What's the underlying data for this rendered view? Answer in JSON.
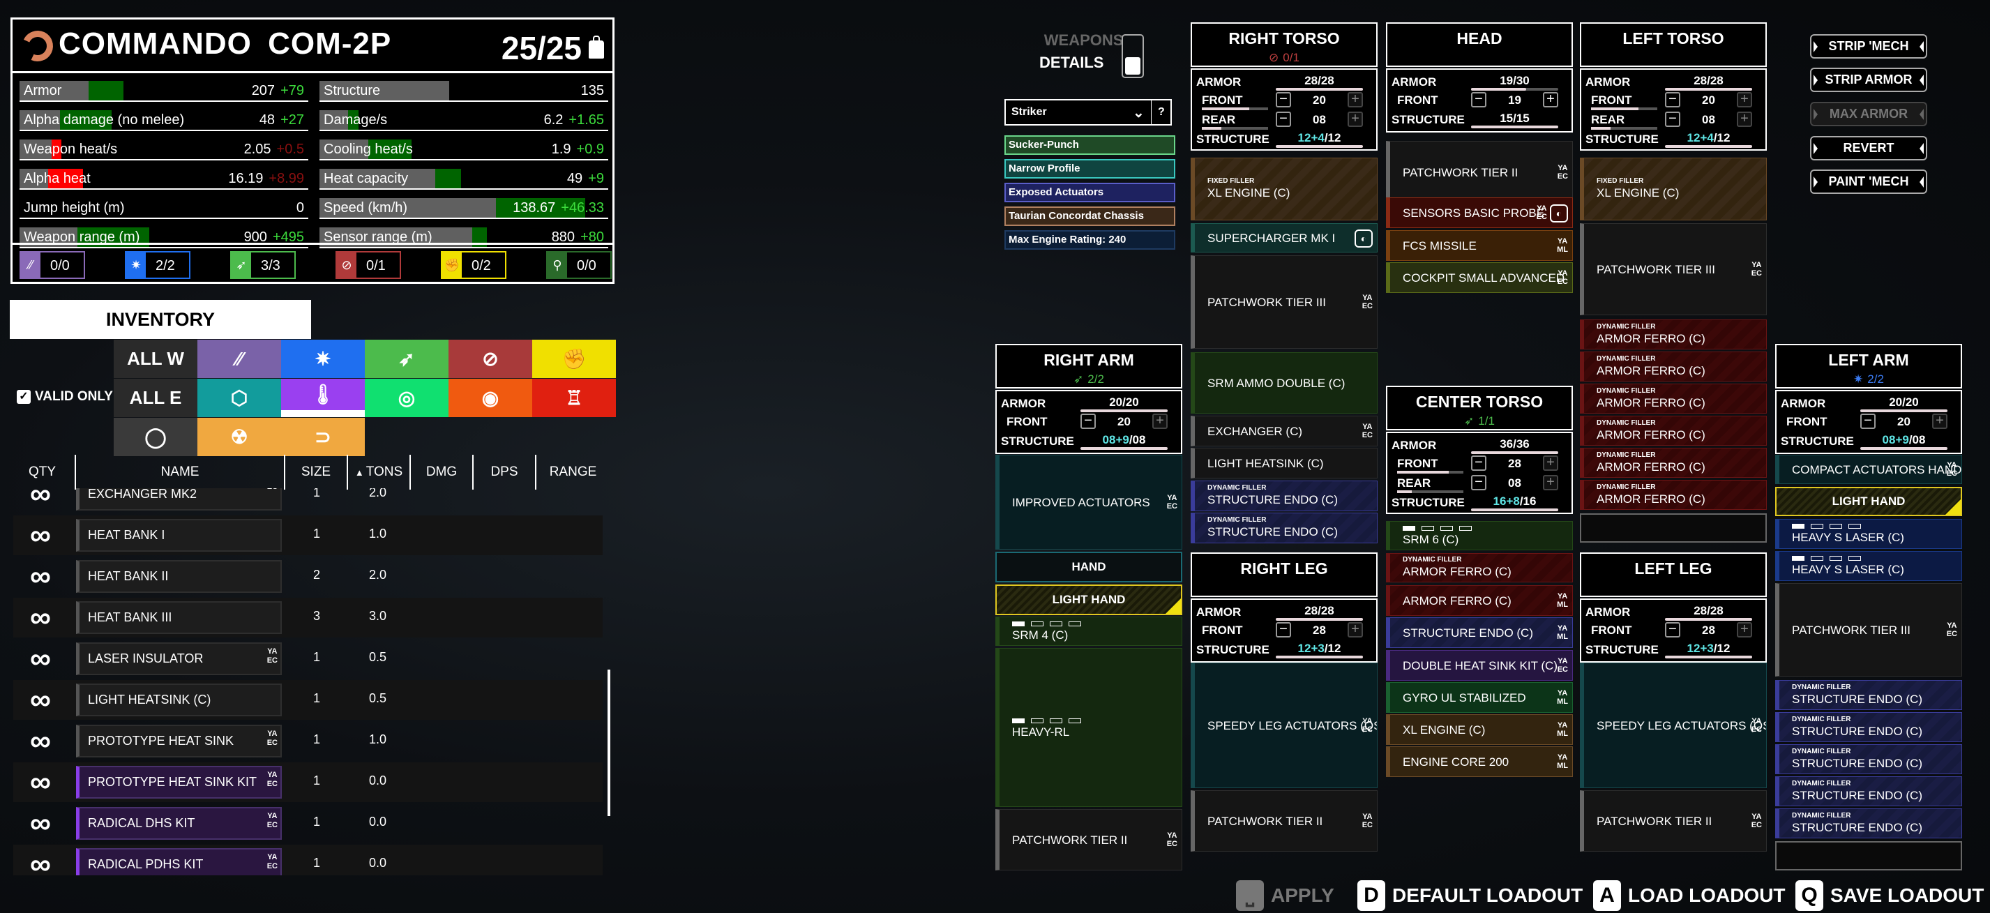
{
  "mech": {
    "name": "COMMANDO  COM-2P",
    "tonnage": "25/25",
    "stats_left": [
      {
        "label": "Armor",
        "value": "207",
        "delta": "+79",
        "delta_sign": "pos",
        "base_frac": 0.24,
        "delta_frac": 0.12,
        "delta_color": "#006400"
      },
      {
        "label": "Alpha damage (no melee)",
        "value": "48",
        "delta": "+27",
        "delta_sign": "pos",
        "base_frac": 0.14,
        "delta_frac": 0.18,
        "delta_color": "#006400"
      },
      {
        "label": "Weapon heat/s",
        "value": "2.05",
        "delta": "+0.5",
        "delta_sign": "neg",
        "base_frac": 0.11,
        "delta_frac": 0.035,
        "delta_color": "#ff0000"
      },
      {
        "label": "Alpha heat",
        "value": "16.19",
        "delta": "+8.99",
        "delta_sign": "neg",
        "base_frac": 0.1,
        "delta_frac": 0.12,
        "delta_color": "#ff0000"
      },
      {
        "label": "Jump height (m)",
        "value": "0",
        "delta": "",
        "delta_sign": "pos",
        "base_frac": 0,
        "delta_frac": 0,
        "delta_color": "#006400"
      },
      {
        "label": "Weapon range (m)",
        "value": "900",
        "delta": "+495",
        "delta_sign": "pos",
        "base_frac": 0.2,
        "delta_frac": 0.25,
        "delta_color": "#006400"
      }
    ],
    "stats_right": [
      {
        "label": "Structure",
        "value": "135",
        "delta": "",
        "delta_sign": "pos",
        "base_frac": 0.45,
        "delta_frac": 0,
        "delta_color": "#006400"
      },
      {
        "label": "Damage/s",
        "value": "6.2",
        "delta": "+1.65",
        "delta_sign": "pos",
        "base_frac": 0.1,
        "delta_frac": 0.035,
        "delta_color": "#006400"
      },
      {
        "label": "Cooling heat/s",
        "value": "1.9",
        "delta": "+0.9",
        "delta_sign": "pos",
        "base_frac": 0.17,
        "delta_frac": 0.15,
        "delta_color": "#006400"
      },
      {
        "label": "Heat capacity",
        "value": "49",
        "delta": "+9",
        "delta_sign": "pos",
        "base_frac": 0.4,
        "delta_frac": 0.09,
        "delta_color": "#006400"
      },
      {
        "label": "Speed (km/h)",
        "value": "138.67",
        "delta": "+46.33",
        "delta_sign": "pos",
        "base_frac": 0.61,
        "delta_frac": 0.31,
        "delta_color": "#006400"
      },
      {
        "label": "Sensor range (m)",
        "value": "880",
        "delta": "+80",
        "delta_sign": "pos",
        "base_frac": 0.53,
        "delta_frac": 0.05,
        "delta_color": "#006400"
      }
    ],
    "hardpoints": [
      {
        "icon": "ballistic-icon",
        "glyph": "⁄⁄",
        "value": "0/0",
        "color": "#8a6ab8"
      },
      {
        "icon": "energy-icon",
        "glyph": "✷",
        "value": "2/2",
        "color": "#1f6ff0"
      },
      {
        "icon": "missile-icon",
        "glyph": "➶",
        "value": "3/3",
        "color": "#4cbb4c"
      },
      {
        "icon": "support-icon",
        "glyph": "⊘",
        "value": "0/1",
        "color": "#b03a3a"
      },
      {
        "icon": "melee-icon",
        "glyph": "✊",
        "value": "0/2",
        "color": "#f0e000"
      },
      {
        "icon": "jumpjet-icon",
        "glyph": "⚲",
        "value": "0/0",
        "color": "#2a6a2a"
      }
    ]
  },
  "inventory": {
    "tab_label": "INVENTORY",
    "valid_only_label": "VALID ONLY",
    "filters_row1": [
      {
        "label": "ALL W",
        "name": "all-weapons",
        "bg": "#2a2a2a"
      },
      {
        "label": "⁄⁄",
        "name": "ballistic",
        "bg": "#7a62a8"
      },
      {
        "label": "✷",
        "name": "energy",
        "bg": "#1f6ff0"
      },
      {
        "label": "➶",
        "name": "missile",
        "bg": "#4cbb4c"
      },
      {
        "label": "⊘",
        "name": "support",
        "bg": "#a83a3a"
      },
      {
        "label": "✊",
        "name": "melee",
        "bg": "#f0e000"
      }
    ],
    "filters_row2": [
      {
        "label": "ALL E",
        "name": "all-equipment",
        "bg": "#2a2a2a"
      },
      {
        "label": "⬡",
        "name": "upgrades",
        "bg": "#129c9c"
      },
      {
        "label": "🌡",
        "name": "heatsinks",
        "bg": "#9a40f0"
      },
      {
        "label": "◎",
        "name": "gyros",
        "bg": "#10e070"
      },
      {
        "label": "◉",
        "name": "sensors",
        "bg": "#f05a10"
      },
      {
        "label": "♖",
        "name": "actuators",
        "bg": "#e02010"
      }
    ],
    "filters_row3": [
      {
        "label": "◯",
        "name": "cockpit",
        "bg": "#3a3a3a"
      },
      {
        "label": "☢",
        "name": "engine",
        "bg": "#f0a840"
      },
      {
        "label": "⊃",
        "name": "jumpjets",
        "bg": "#f0a840"
      }
    ],
    "columns": [
      "QTY",
      "NAME",
      "SIZE",
      "TONS",
      "DMG",
      "DPS",
      "RANGE"
    ],
    "sort_column": "TONS",
    "rows": [
      {
        "qty": "∞",
        "name": "EXCHANGER MK2",
        "size": "1",
        "tons": "2.0",
        "mfr": "EC",
        "color": "grey"
      },
      {
        "qty": "∞",
        "name": "HEAT BANK I",
        "size": "1",
        "tons": "1.0",
        "mfr": "",
        "color": "grey"
      },
      {
        "qty": "∞",
        "name": "HEAT BANK II",
        "size": "2",
        "tons": "2.0",
        "mfr": "",
        "color": "grey"
      },
      {
        "qty": "∞",
        "name": "HEAT BANK III",
        "size": "3",
        "tons": "3.0",
        "mfr": "",
        "color": "grey"
      },
      {
        "qty": "∞",
        "name": "LASER INSULATOR",
        "size": "1",
        "tons": "0.5",
        "mfr": "YA EC",
        "color": "grey"
      },
      {
        "qty": "∞",
        "name": "LIGHT HEATSINK (C)",
        "size": "1",
        "tons": "0.5",
        "mfr": "",
        "color": "grey"
      },
      {
        "qty": "∞",
        "name": "PROTOTYPE HEAT SINK",
        "size": "1",
        "tons": "1.0",
        "mfr": "YA EC",
        "color": "grey"
      },
      {
        "qty": "∞",
        "name": "PROTOTYPE HEAT SINK KIT",
        "size": "1",
        "tons": "0.0",
        "mfr": "YA EC",
        "color": "purple"
      },
      {
        "qty": "∞",
        "name": "RADICAL DHS KIT",
        "size": "1",
        "tons": "0.0",
        "mfr": "YA EC",
        "color": "purple"
      },
      {
        "qty": "∞",
        "name": "RADICAL PDHS KIT",
        "size": "1",
        "tons": "0.0",
        "mfr": "YA EC",
        "color": "purple"
      }
    ]
  },
  "details": {
    "weapons_label": "WEAPONS",
    "details_label": "DETAILS",
    "quirk_select": "Striker",
    "help": "?",
    "quirks": [
      {
        "label": "Sucker-Punch",
        "bg": "#1f4a26",
        "border": "#6ad68a"
      },
      {
        "label": "Narrow Profile",
        "bg": "#0f4440",
        "border": "#3ac8c0"
      },
      {
        "label": "Exposed Actuators",
        "bg": "#1e2260",
        "border": "#5a5ec8"
      },
      {
        "label": "Taurian Concordat Chassis",
        "bg": "#3a2818",
        "border": "#b08060"
      },
      {
        "label": "Max Engine Rating:  240",
        "bg": "#0c1e36",
        "border": "#1e3a60"
      }
    ]
  },
  "components": {
    "right_torso": {
      "title": "RIGHT TORSO",
      "hardpoint": "0/1",
      "armor": "28/28",
      "front": "20",
      "rear": "08",
      "structure_base": "12",
      "structure_bonus": "+4",
      "structure_max": "/12",
      "front_frac": 0.72,
      "rear_frac": 0.29
    },
    "head": {
      "title": "HEAD",
      "armor": "19/30",
      "armor_frac": 0.63,
      "front": "19",
      "structure": "15/15"
    },
    "left_torso": {
      "title": "LEFT TORSO",
      "armor": "28/28",
      "front": "20",
      "rear": "08",
      "structure_base": "12",
      "structure_bonus": "+4",
      "structure_max": "/12",
      "front_frac": 0.72,
      "rear_frac": 0.29
    },
    "right_arm": {
      "title": "RIGHT ARM",
      "hardpoint": "2/2",
      "armor": "20/20",
      "front": "20",
      "structure_base": "08",
      "structure_bonus": "+9",
      "structure_max": "/08"
    },
    "center_torso": {
      "title": "CENTER TORSO",
      "hardpoint": "1/1",
      "armor": "36/36",
      "front": "28",
      "rear": "08",
      "structure_base": "16",
      "structure_bonus": "+8",
      "structure_max": "/16",
      "front_frac": 0.78,
      "rear_frac": 0.22
    },
    "left_arm": {
      "title": "LEFT ARM",
      "hardpoint": "2/2",
      "armor": "20/20",
      "front": "20",
      "structure_base": "08",
      "structure_bonus": "+9",
      "structure_max": "/08"
    },
    "right_leg": {
      "title": "RIGHT LEG",
      "armor": "28/28",
      "front": "28",
      "structure_base": "12",
      "structure_bonus": "+3",
      "structure_max": "/12"
    },
    "left_leg": {
      "title": "LEFT LEG",
      "armor": "28/28",
      "front": "28",
      "structure_base": "12",
      "structure_bonus": "+3",
      "structure_max": "/12"
    },
    "labels": {
      "armor": "ARMOR",
      "front": "FRONT",
      "rear": "REAR",
      "structure": "STRUCTURE",
      "hand": "HAND",
      "light_hand": "LIGHT HAND",
      "fixed_filler": "FIXED FILLER",
      "dynamic_filler": "DYNAMIC FILLER"
    }
  },
  "slots": {
    "right_torso": [
      {
        "name": "XL ENGINE (C)",
        "filler": "FIXED FILLER"
      },
      {
        "name": "SUPERCHARGER MK I"
      },
      {
        "name": "PATCHWORK TIER III",
        "mfr": "YA EC"
      },
      {
        "name": "SRM AMMO DOUBLE (C)"
      },
      {
        "name": "EXCHANGER (C)",
        "mfr": "YA EC"
      },
      {
        "name": "LIGHT HEATSINK (C)"
      },
      {
        "name": "STRUCTURE ENDO (C)",
        "filler": "DYNAMIC FILLER"
      },
      {
        "name": "STRUCTURE ENDO (C)",
        "filler": "DYNAMIC FILLER"
      }
    ],
    "head": [
      {
        "name": "PATCHWORK TIER II",
        "mfr": "YA EC"
      },
      {
        "name": "SENSORS BASIC PROBE",
        "mfr": "YA EC"
      },
      {
        "name": "FCS MISSILE",
        "mfr": "YA ML"
      },
      {
        "name": "COCKPIT SMALL ADVANCED",
        "mfr": "YA EC"
      }
    ],
    "left_torso": [
      {
        "name": "XL ENGINE (C)",
        "filler": "FIXED FILLER"
      },
      {
        "name": "PATCHWORK TIER III",
        "mfr": "YA EC"
      },
      {
        "name": "ARMOR FERRO (C)",
        "filler": "DYNAMIC FILLER"
      },
      {
        "name": "ARMOR FERRO (C)",
        "filler": "DYNAMIC FILLER"
      },
      {
        "name": "ARMOR FERRO (C)",
        "filler": "DYNAMIC FILLER"
      },
      {
        "name": "ARMOR FERRO (C)",
        "filler": "DYNAMIC FILLER"
      },
      {
        "name": "ARMOR FERRO (C)",
        "filler": "DYNAMIC FILLER"
      },
      {
        "name": "ARMOR FERRO (C)",
        "filler": "DYNAMIC FILLER"
      }
    ],
    "right_arm": [
      {
        "name": "IMPROVED ACTUATORS",
        "mfr": "YA EC"
      },
      {
        "name": "SRM 4 (C)"
      },
      {
        "name": "HEAVY-RL"
      },
      {
        "name": "PATCHWORK TIER II",
        "mfr": "YA EC"
      }
    ],
    "center_torso": [
      {
        "name": "SRM 6 (C)"
      },
      {
        "name": "ARMOR FERRO (C)",
        "filler": "DYNAMIC FILLER"
      },
      {
        "name": "ARMOR FERRO (C)",
        "mfr": "YA ML"
      },
      {
        "name": "STRUCTURE ENDO (C)",
        "mfr": "YA ML"
      },
      {
        "name": "DOUBLE HEAT SINK KIT (C)",
        "mfr": "YA EC"
      },
      {
        "name": "GYRO UL STABILIZED",
        "mfr": "YA ML"
      },
      {
        "name": "XL ENGINE (C)",
        "mfr": "YA ML"
      },
      {
        "name": "ENGINE CORE 200",
        "mfr": "YA ML"
      }
    ],
    "left_arm": [
      {
        "name": "COMPACT ACTUATORS HAND (QS)",
        "mfr": "YA EC"
      },
      {
        "name": "HEAVY S LASER (C)"
      },
      {
        "name": "HEAVY S LASER (C)"
      },
      {
        "name": "PATCHWORK TIER III",
        "mfr": "YA EC"
      },
      {
        "name": "STRUCTURE ENDO (C)",
        "filler": "DYNAMIC FILLER"
      },
      {
        "name": "STRUCTURE ENDO (C)",
        "filler": "DYNAMIC FILLER"
      },
      {
        "name": "STRUCTURE ENDO (C)",
        "filler": "DYNAMIC FILLER"
      },
      {
        "name": "STRUCTURE ENDO (C)",
        "filler": "DYNAMIC FILLER"
      },
      {
        "name": "STRUCTURE ENDO (C)",
        "filler": "DYNAMIC FILLER"
      }
    ],
    "right_leg": [
      {
        "name": "SPEEDY LEG ACTUATORS (QS)",
        "mfr": "YA EC"
      },
      {
        "name": "PATCHWORK TIER II",
        "mfr": "YA EC"
      }
    ],
    "left_leg": [
      {
        "name": "SPEEDY LEG ACTUATORS (QS)",
        "mfr": "YA EC"
      },
      {
        "name": "PATCHWORK TIER II",
        "mfr": "YA EC"
      }
    ]
  },
  "actions": {
    "strip_mech": "STRIP 'MECH",
    "strip_armor": "STRIP ARMOR",
    "max_armor": "MAX ARMOR",
    "revert": "REVERT",
    "paint_mech": "PAINT 'MECH"
  },
  "bottom_bar": [
    {
      "key": "⎵",
      "label": "APPLY",
      "enabled": false
    },
    {
      "key": "D",
      "label": "DEFAULT LOADOUT",
      "enabled": true
    },
    {
      "key": "A",
      "label": "LOAD LOADOUT",
      "enabled": true
    },
    {
      "key": "Q",
      "label": "SAVE LOADOUT",
      "enabled": true
    }
  ]
}
